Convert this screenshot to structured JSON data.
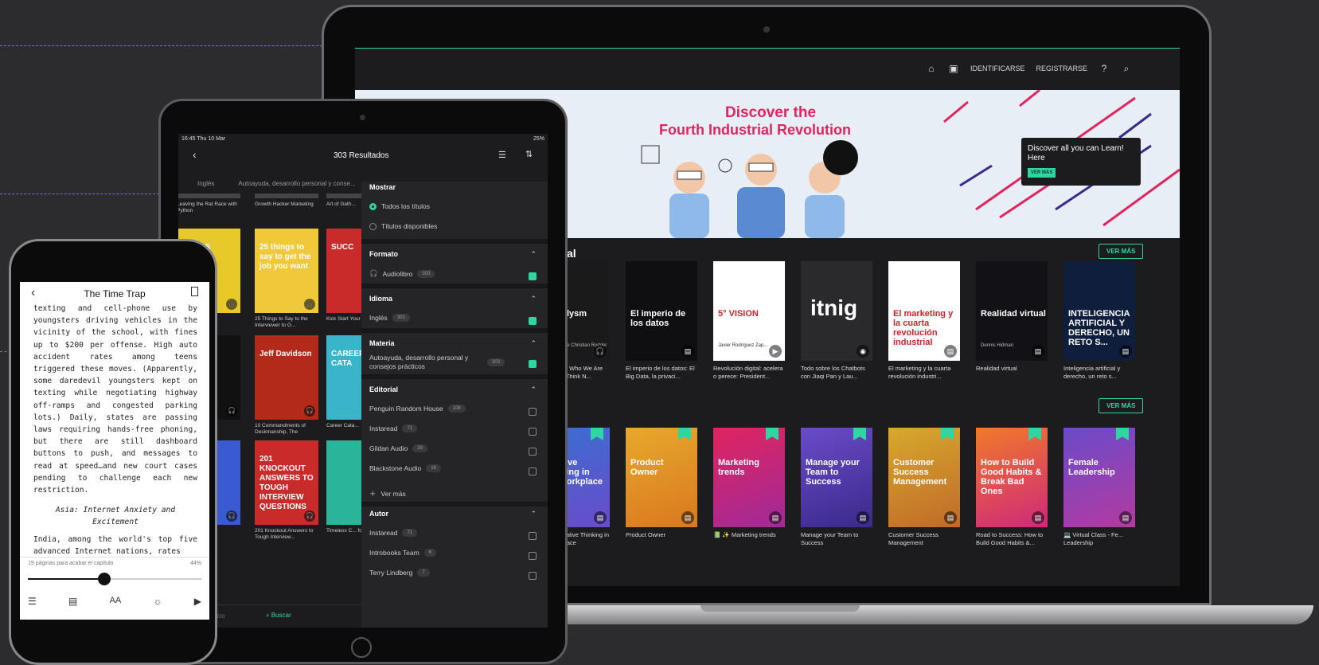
{
  "laptop": {
    "nav": {
      "login": "IDENTIFICARSE",
      "register": "REGISTRARSE"
    },
    "hero": {
      "line1": "Discover the",
      "line2": "Fourth Industrial Revolution",
      "card_text": "Discover all you can Learn! Here",
      "card_button": "VER MÁS"
    },
    "section1": {
      "title": "al",
      "button": "VER MÁS",
      "books": [
        {
          "cover_title": "Dataclysm",
          "cover_sub": "Who We Are Christian Rudder",
          "title": "Dataclysm: Who We Are When We Think N...",
          "bg": "#1a1a1a",
          "icon": "headphones-icon"
        },
        {
          "cover_title": "El imperio de los datos",
          "cover_sub": "",
          "title": "El imperio de los datos: El Big Data, la privaci...",
          "bg": "#0f0f12",
          "icon": "document-icon"
        },
        {
          "cover_title": "5° VISION",
          "cover_sub": "Javier Rodríguez Zap...",
          "title": "Revolución digital: acelera o perece: President...",
          "bg": "#ffffff",
          "icon": "video-icon"
        },
        {
          "cover_title": "itnig",
          "cover_sub": "",
          "title": "Todo sobre los Chatbots con Jiaqi Pan y Lau...",
          "bg": "#2a2a2c",
          "icon": "podcast-icon"
        },
        {
          "cover_title": "El marketing y la cuarta revolución industrial",
          "cover_sub": "",
          "title": "El marketing y la cuarta revolución industri...",
          "bg": "#ffffff",
          "icon": "document-icon"
        },
        {
          "cover_title": "Realidad virtual",
          "cover_sub": "Dennis Hidman",
          "title": "Realidad virtual",
          "bg": "#121216",
          "icon": "document-icon"
        },
        {
          "cover_title": "INTELIGENCIA ARTIFICIAL Y DERECHO, UN RETO S...",
          "cover_sub": "",
          "title": "Inteligencia artificial y derecho, un reto s...",
          "bg": "#0e1e3c",
          "icon": "document-icon"
        }
      ]
    },
    "section2": {
      "button": "VER MÁS",
      "books": [
        {
          "cover_title": "Creative Thinking in the Workplace",
          "title": "📖 💡 Creative Thinking in the Workplace",
          "bg": "#3a6fd1",
          "bg2": "#6a4bc9"
        },
        {
          "cover_title": "Product Owner",
          "title": "Product Owner",
          "bg": "#e7a92c",
          "bg2": "#d9781f"
        },
        {
          "cover_title": "Marketing trends",
          "title": "📗 ✨ Marketing trends",
          "bg": "#e0245e",
          "bg2": "#a02a9a"
        },
        {
          "cover_title": "Manage your Team to Success",
          "title": "Manage your Team to Success",
          "bg": "#6a4bc9",
          "bg2": "#3a2a8a"
        },
        {
          "cover_title": "Customer Success Management",
          "title": "Customer Success Management",
          "bg": "#d7a92c",
          "bg2": "#c06a2a"
        },
        {
          "cover_title": "How to Build Good Habits & Break Bad Ones",
          "title": "Road to Success: How to Build Good Habits &...",
          "bg": "#f07a2a",
          "bg2": "#d0287a"
        },
        {
          "cover_title": "Female Leadership",
          "title": "💻 Virtual Class - Fe... Leadership",
          "bg": "#6a4bc9",
          "bg2": "#b43aa0"
        }
      ]
    }
  },
  "tablet": {
    "status": {
      "time": "16:45  Thu 10 Mar",
      "battery": "25%"
    },
    "title": "303 Resultados",
    "chips": [
      "Inglés",
      "Autoayuda, desarrollo personal y conse..."
    ],
    "books": [
      {
        "title": "Leaving the Rat Race with Python",
        "col": 0,
        "row": 0,
        "bg": "#444"
      },
      {
        "title": "Growth Hacker Marketing",
        "col": 1,
        "row": 0,
        "bg": "#444"
      },
      {
        "title": "Art of Gath...",
        "col": 2,
        "row": 0,
        "bg": "#444"
      },
      {
        "title": "",
        "cover": "SIBLES",
        "col": 0,
        "row": 1,
        "bg": "#e8c92a"
      },
      {
        "title": "25 Things to Say to the Interviewer to G...",
        "cover": "25 things to say to get the job you want",
        "col": 1,
        "row": 1,
        "bg": "#f0c93a"
      },
      {
        "title": "Kick Start Your Succe...",
        "cover": "SUCC",
        "col": 2,
        "row": 1,
        "bg": "#c92a2a"
      },
      {
        "title": "",
        "cover": "AY GER",
        "col": 0,
        "row": 2,
        "bg": "#111"
      },
      {
        "title": "10 Commandments of Deskmanship, The",
        "cover": "Jeff Davidson",
        "col": 1,
        "row": 2,
        "bg": "#b42a1a"
      },
      {
        "title": "Career Cata...",
        "cover": "CAREER CATA",
        "col": 2,
        "row": 2,
        "bg": "#3ab4c9"
      },
      {
        "title": "...More ...the Job",
        "cover": "vidson",
        "col": 0,
        "row": 3,
        "bg": "#3a5ad1"
      },
      {
        "title": "201 Knockout Answers to Tough Interview...",
        "cover": "201 KNOCKOUT ANSWERS TO TOUGH INTERVIEW QUESTIONS",
        "col": 1,
        "row": 3,
        "bg": "#c92a2a"
      },
      {
        "title": "Timeless C... for the Mo...",
        "cover": "",
        "col": 2,
        "row": 3,
        "bg": "#2ab49a"
      }
    ],
    "filter": {
      "mostrar": {
        "title": "Mostrar",
        "options": [
          "Todos los títulos",
          "Títulos disponibles"
        ]
      },
      "formato": {
        "title": "Formato",
        "item": "Audiolibro",
        "count": "303"
      },
      "idioma": {
        "title": "Idioma",
        "item": "Inglés",
        "count": "303"
      },
      "materia": {
        "title": "Materia",
        "item": "Autoayuda, desarrollo personal y consejos prácticos",
        "count": "303"
      },
      "editorial": {
        "title": "Editorial",
        "items": [
          {
            "name": "Penguin Random House",
            "count": "108"
          },
          {
            "name": "Instaread",
            "count": "71"
          },
          {
            "name": "Gildan Audio",
            "count": "29"
          },
          {
            "name": "Blackstone Audio",
            "count": "16"
          }
        ],
        "more": "Ver más"
      },
      "autor": {
        "title": "Autor",
        "items": [
          {
            "name": "Instaread",
            "count": "71"
          },
          {
            "name": "Introbooks Team",
            "count": "6"
          },
          {
            "name": "Terry Lindberg",
            "count": "7"
          }
        ]
      }
    },
    "tabbar": {
      "home": "Inicio",
      "search": "Buscar"
    }
  },
  "phone": {
    "title": "The Time Trap",
    "body": "texting and cell-phone use by youngsters driving vehicles in the vicinity of the school, with fines up to $200 per offense. High auto accident rates among teens triggered these moves. (Apparently, some daredevil youngsters kept on texting while negotiating highway off-ramps and congested parking lots.) Daily, states are passing laws requiring hands-free phoning, but there are still dashboard buttons to push, and messages to read at speed…and new court cases pending to challenge each new restriction.",
    "subtitle": "Asia: Internet Anxiety and Excitement",
    "body2": "India, among the world's top five advanced Internet nations, rates",
    "progress_text": "19 páginas para acabar el capítulo",
    "progress_pct": "44%",
    "progress": 0.44
  }
}
